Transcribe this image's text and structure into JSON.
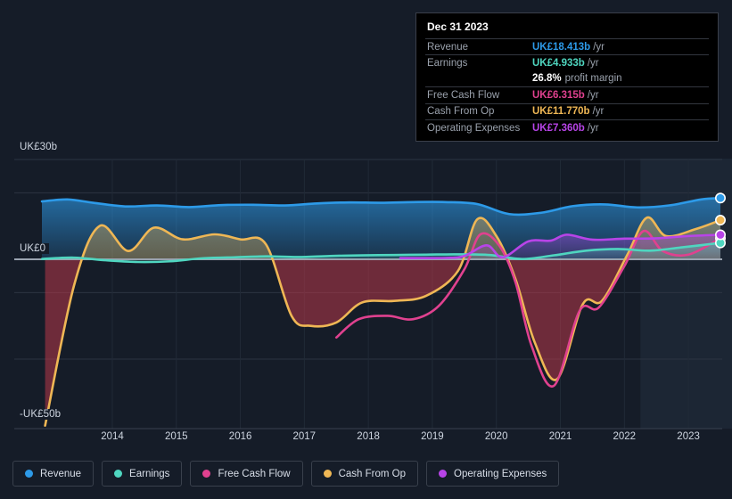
{
  "chart_data": {
    "type": "area",
    "title": "",
    "xlabel": "",
    "ylabel": "",
    "currency_prefix": "UK£",
    "grid": true,
    "legend_position": "bottom",
    "ylim": [
      -50,
      30
    ],
    "y_ticks": [
      {
        "value": 30,
        "label": "UK£30b"
      },
      {
        "value": 0,
        "label": "UK£0"
      },
      {
        "value": -50,
        "label": "-UK£50b"
      }
    ],
    "x_ticks": [
      "2014",
      "2015",
      "2016",
      "2017",
      "2018",
      "2019",
      "2020",
      "2021",
      "2022",
      "2023"
    ],
    "x_range": [
      "2013.4",
      "2024.0"
    ],
    "forecast_region_start": "2022.75",
    "series": [
      {
        "name": "Revenue",
        "color": "#2d9ae8",
        "unit": "b/yr",
        "x": [
          2013.4,
          2013.8,
          2014.2,
          2014.7,
          2015.2,
          2015.7,
          2016.2,
          2016.7,
          2017.2,
          2017.7,
          2018.2,
          2018.7,
          2019.2,
          2019.7,
          2020.2,
          2020.7,
          2021.2,
          2021.7,
          2022.2,
          2022.7,
          2023.2,
          2023.7,
          2024.0
        ],
        "values": [
          17.4,
          18.0,
          17.0,
          15.9,
          16.2,
          15.7,
          16.3,
          16.4,
          16.2,
          16.8,
          17.1,
          17.0,
          17.2,
          17.2,
          16.6,
          13.6,
          14.0,
          16.0,
          16.5,
          15.6,
          16.2,
          18.0,
          18.413
        ]
      },
      {
        "name": "Earnings",
        "color": "#4fd6c0",
        "unit": "b/yr",
        "x": [
          2013.4,
          2013.9,
          2014.4,
          2014.9,
          2015.4,
          2015.9,
          2016.4,
          2016.9,
          2017.4,
          2017.9,
          2018.4,
          2018.9,
          2019.4,
          2019.9,
          2020.4,
          2020.9,
          2021.4,
          2021.9,
          2022.4,
          2022.9,
          2023.4,
          2024.0
        ],
        "values": [
          0.1,
          0.5,
          -0.3,
          -0.8,
          -0.6,
          0.3,
          0.6,
          0.9,
          0.7,
          1.0,
          1.2,
          1.3,
          1.4,
          1.5,
          1.3,
          0.1,
          1.2,
          2.6,
          3.1,
          2.6,
          3.6,
          4.933
        ]
      },
      {
        "name": "Free Cash Flow",
        "color": "#e0418f",
        "unit": "b/yr",
        "x": [
          2018.0,
          2018.35,
          2018.8,
          2019.2,
          2019.6,
          2020.0,
          2020.25,
          2020.55,
          2020.8,
          2021.05,
          2021.4,
          2021.8,
          2022.1,
          2022.5,
          2022.8,
          2023.1,
          2023.5,
          2024.0
        ],
        "values": [
          -23.5,
          -18.0,
          -17.0,
          -18.0,
          -14.0,
          -3.0,
          7.5,
          4.0,
          -7.0,
          -26.0,
          -38.0,
          -15.5,
          -14.5,
          -2.0,
          8.5,
          2.5,
          1.4,
          6.315
        ]
      },
      {
        "name": "Cash From Op",
        "color": "#efb755",
        "unit": "b/yr",
        "x": [
          2013.45,
          2013.9,
          2014.3,
          2014.75,
          2015.15,
          2015.6,
          2016.1,
          2016.5,
          2016.9,
          2017.3,
          2017.6,
          2018.0,
          2018.4,
          2018.9,
          2019.4,
          2019.9,
          2020.2,
          2020.5,
          2020.8,
          2021.1,
          2021.45,
          2021.85,
          2022.15,
          2022.55,
          2022.85,
          2023.15,
          2023.6,
          2024.0
        ],
        "values": [
          -50.0,
          -8.0,
          10.0,
          2.5,
          9.5,
          6.0,
          7.5,
          6.0,
          4.5,
          -17.0,
          -20.0,
          -19.0,
          -13.0,
          -12.5,
          -11.0,
          -3.5,
          12.0,
          7.0,
          -6.0,
          -25.0,
          -36.0,
          -13.5,
          -12.5,
          1.5,
          12.5,
          7.0,
          9.0,
          11.77
        ]
      },
      {
        "name": "Operating Expenses",
        "color": "#b844e8",
        "unit": "b/yr",
        "x": [
          2019.0,
          2019.7,
          2020.0,
          2020.35,
          2020.6,
          2021.0,
          2021.35,
          2021.6,
          2022.0,
          2022.5,
          2023.0,
          2023.5,
          2024.0
        ],
        "values": [
          0.35,
          0.4,
          1.0,
          4.2,
          0.6,
          5.4,
          5.6,
          7.4,
          5.9,
          6.2,
          6.3,
          7.0,
          7.36
        ]
      }
    ]
  },
  "tooltip": {
    "date": "Dec 31 2023",
    "rows": [
      {
        "key": "Revenue",
        "value": "UK£18.413b",
        "unit": "/yr",
        "color": "#2d9ae8",
        "sub": ""
      },
      {
        "key": "Earnings",
        "value": "UK£4.933b",
        "unit": "/yr",
        "color": "#4fd6c0",
        "sub": ""
      },
      {
        "key": "",
        "value": "26.8%",
        "unit": "",
        "color": "#ffffff",
        "sub": "profit margin"
      },
      {
        "key": "Free Cash Flow",
        "value": "UK£6.315b",
        "unit": "/yr",
        "color": "#e0418f",
        "sub": ""
      },
      {
        "key": "Cash From Op",
        "value": "UK£11.770b",
        "unit": "/yr",
        "color": "#efb755",
        "sub": ""
      },
      {
        "key": "Operating Expenses",
        "value": "UK£7.360b",
        "unit": "/yr",
        "color": "#b844e8",
        "sub": ""
      }
    ]
  },
  "legend": {
    "items": [
      {
        "label": "Revenue",
        "color": "#2d9ae8"
      },
      {
        "label": "Earnings",
        "color": "#4fd6c0"
      },
      {
        "label": "Free Cash Flow",
        "color": "#e0418f"
      },
      {
        "label": "Cash From Op",
        "color": "#efb755"
      },
      {
        "label": "Operating Expenses",
        "color": "#b844e8"
      }
    ]
  },
  "theme": {
    "background": "#151c28",
    "grid_line": "#303845",
    "zero_line": "#9aa3b0",
    "negative_fill": "#7a2230",
    "forecast_band": "#1b2troubles"
  }
}
